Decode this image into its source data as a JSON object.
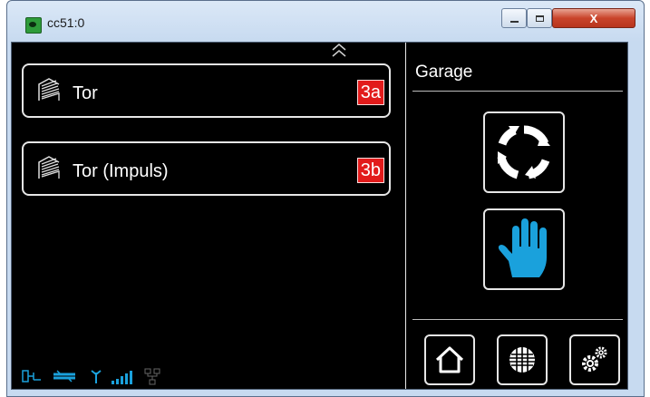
{
  "window": {
    "title": "cc51:0",
    "close_label": "X"
  },
  "list": {
    "items": [
      {
        "label": "Tor",
        "badge": "3a"
      },
      {
        "label": "Tor (Impuls)",
        "badge": "3b"
      }
    ]
  },
  "panel": {
    "title": "Garage"
  },
  "icons": {
    "app": "app-icon",
    "scroll": "chevron-up-icon",
    "gate": "garage-gate-icon",
    "refresh": "refresh-icon",
    "stop": "hand-stop-icon",
    "home": "home-icon",
    "media": "speaker-grid-icon",
    "settings": "gears-icon",
    "status": [
      "plug-icon",
      "ethernet-icon",
      "antenna-icon",
      "signal-bars-icon",
      "network-icon"
    ]
  },
  "colors": {
    "accent": "#1aa1dc",
    "badge": "#e21b1b",
    "screen_bg": "#000000"
  }
}
